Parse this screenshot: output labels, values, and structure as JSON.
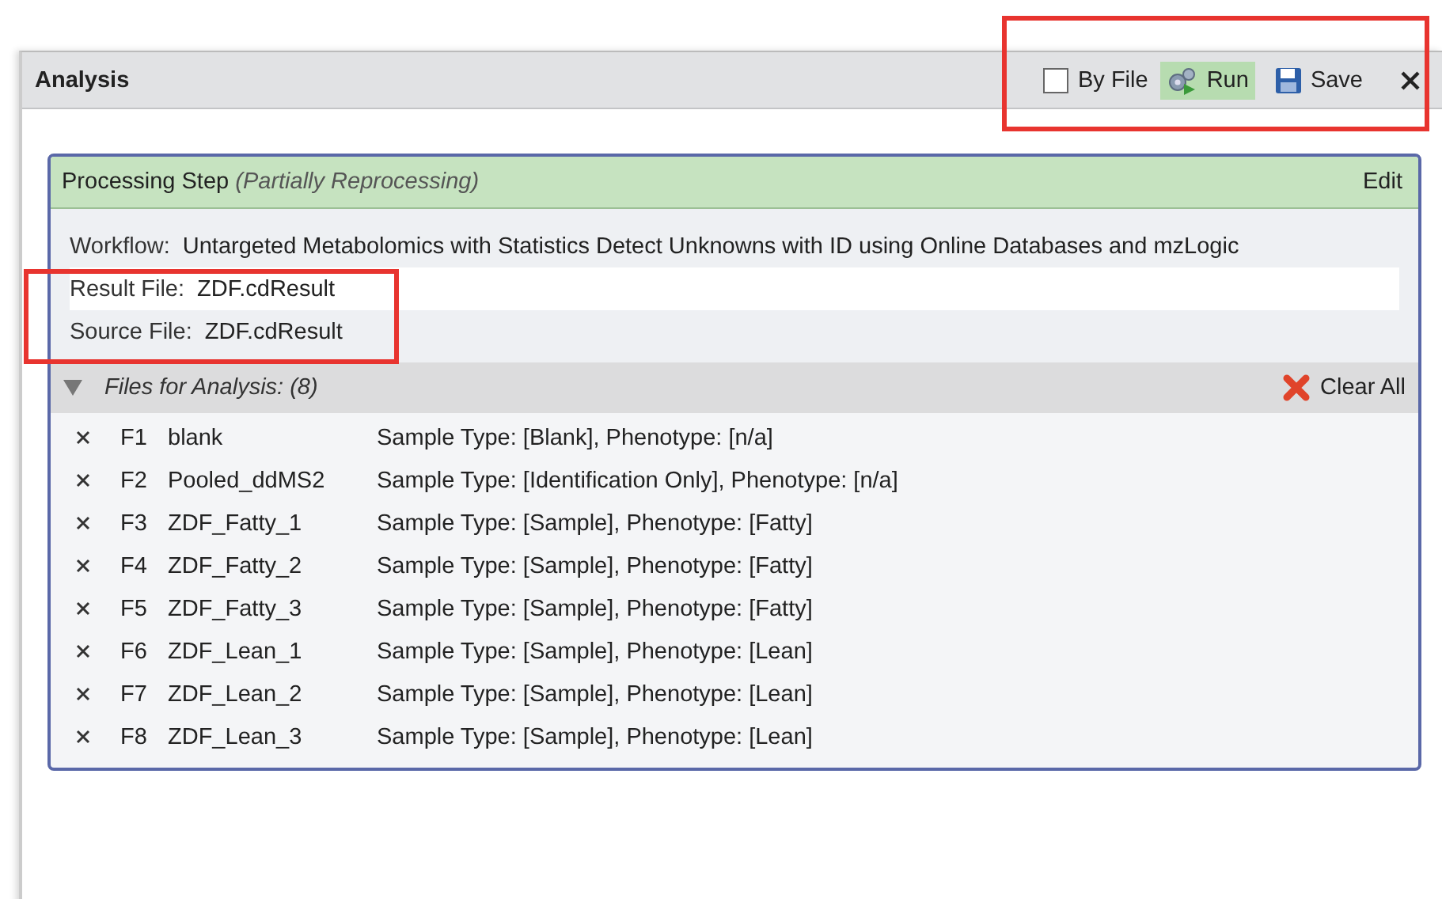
{
  "panel": {
    "title": "Analysis"
  },
  "toolbar": [
    {
      "kind": "checkbox",
      "label": "By File",
      "checked": false
    },
    {
      "kind": "run",
      "label": "Run",
      "highlighted": true
    },
    {
      "kind": "save",
      "label": "Save",
      "highlighted": false
    },
    {
      "kind": "close"
    }
  ],
  "processing_step": {
    "title": "Processing Step",
    "status": "(Partially Reprocessing)",
    "action": "Edit"
  },
  "fields": [
    {
      "label": "Workflow:",
      "value": "Untargeted Metabolomics with Statistics Detect Unknowns with ID using Online Databases and mzLogic",
      "selected": false
    },
    {
      "label": "Result File:",
      "value": "ZDF.cdResult",
      "selected": true
    },
    {
      "label": "Source File:",
      "value": "ZDF.cdResult",
      "selected": false
    }
  ],
  "files": {
    "title": "Files for Analysis: (8)",
    "expanded": true,
    "clear_label": "Clear All",
    "rows": [
      {
        "id": "F1",
        "name": "blank",
        "info": "Sample Type: [Blank], Phenotype: [n/a]"
      },
      {
        "id": "F2",
        "name": "Pooled_ddMS2",
        "info": "Sample Type: [Identification Only], Phenotype: [n/a]"
      },
      {
        "id": "F3",
        "name": "ZDF_Fatty_1",
        "info": "Sample Type: [Sample], Phenotype: [Fatty]"
      },
      {
        "id": "F4",
        "name": "ZDF_Fatty_2",
        "info": "Sample Type: [Sample], Phenotype: [Fatty]"
      },
      {
        "id": "F5",
        "name": "ZDF_Fatty_3",
        "info": "Sample Type: [Sample], Phenotype: [Fatty]"
      },
      {
        "id": "F6",
        "name": "ZDF_Lean_1",
        "info": "Sample Type: [Sample], Phenotype: [Lean]"
      },
      {
        "id": "F7",
        "name": "ZDF_Lean_2",
        "info": "Sample Type: [Sample], Phenotype: [Lean]"
      },
      {
        "id": "F8",
        "name": "ZDF_Lean_3",
        "info": "Sample Type: [Sample], Phenotype: [Lean]"
      }
    ]
  },
  "annotations": {
    "toolbar_boxed": true,
    "file_fields_boxed": true
  }
}
